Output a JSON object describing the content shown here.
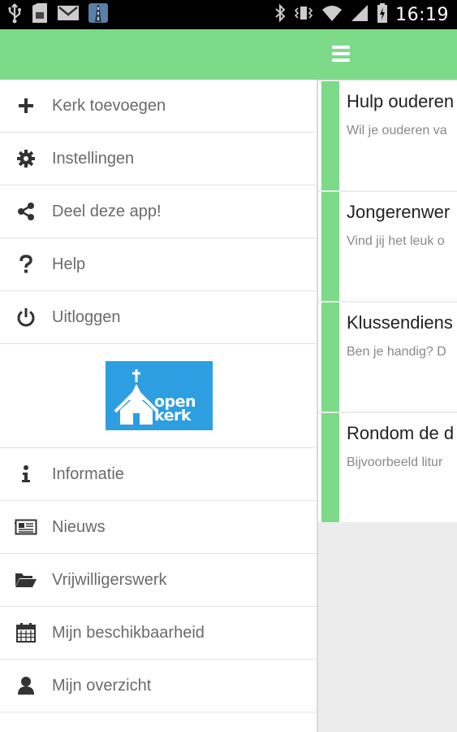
{
  "status_bar": {
    "time": "16:19",
    "left_icons": [
      "usb-icon",
      "sd-card-icon",
      "gmail-icon",
      "road-app-icon"
    ],
    "right_icons": [
      "bluetooth-icon",
      "vibrate-icon",
      "wifi-icon",
      "signal-icon",
      "battery-charging-icon"
    ]
  },
  "app_bar": {
    "color": "#7dda88",
    "menu_icon": "hamburger-menu-icon"
  },
  "drawer": {
    "items_top": [
      {
        "icon": "plus-icon",
        "label": "Kerk toevoegen"
      },
      {
        "icon": "gear-icon",
        "label": "Instellingen"
      },
      {
        "icon": "share-icon",
        "label": "Deel deze app!"
      },
      {
        "icon": "question-icon",
        "label": "Help"
      },
      {
        "icon": "power-icon",
        "label": "Uitloggen"
      }
    ],
    "logo": {
      "line1": "open",
      "line2": "kerk",
      "color": "#2d9ee0"
    },
    "items_bottom": [
      {
        "icon": "info-icon",
        "label": "Informatie"
      },
      {
        "icon": "newspaper-icon",
        "label": "Nieuws"
      },
      {
        "icon": "folder-open-icon",
        "label": "Vrijwilligerswerk"
      },
      {
        "icon": "calendar-icon",
        "label": "Mijn beschikbaarheid"
      },
      {
        "icon": "user-icon",
        "label": "Mijn overzicht"
      },
      {
        "icon": "user-plus-icon",
        "label": ""
      }
    ]
  },
  "content": {
    "cards": [
      {
        "title": "Hulp ouderen",
        "description": "Wil je ouderen va"
      },
      {
        "title": "Jongerenwer",
        "description": "Vind jij het leuk o"
      },
      {
        "title": "Klussendiens",
        "description": "Ben je handig? D"
      },
      {
        "title": "Rondom de d",
        "description": "Bijvoorbeeld litur"
      }
    ]
  }
}
